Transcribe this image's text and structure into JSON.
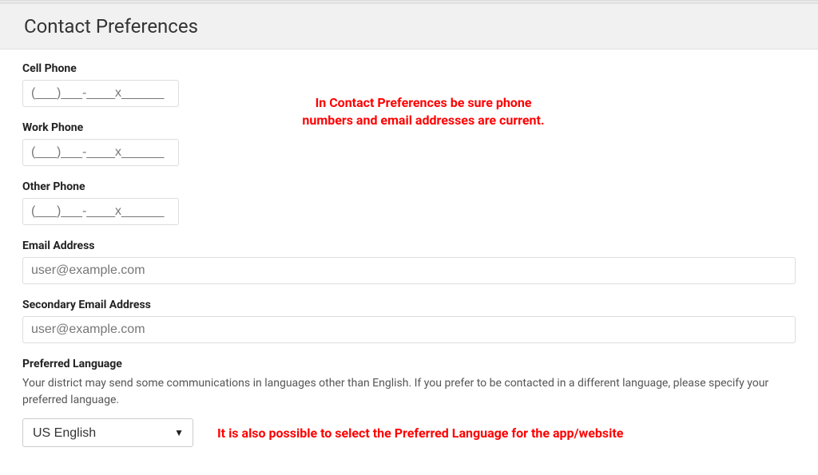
{
  "header": {
    "title": "Contact Preferences"
  },
  "fields": {
    "cell_phone": {
      "label": "Cell Phone",
      "placeholder": "(___)___-____x______"
    },
    "work_phone": {
      "label": "Work Phone",
      "placeholder": "(___)___-____x______"
    },
    "other_phone": {
      "label": "Other Phone",
      "placeholder": "(___)___-____x______"
    },
    "email": {
      "label": "Email Address",
      "placeholder": "user@example.com"
    },
    "secondary_email": {
      "label": "Secondary Email Address",
      "placeholder": "user@example.com"
    },
    "preferred_language": {
      "label": "Preferred Language",
      "help": "Your district may send some communications in languages other than English. If you prefer to be contacted in a different language, please specify your preferred language.",
      "value": "US English"
    }
  },
  "callouts": {
    "top": "In Contact Preferences be sure phone numbers and email addresses are current.",
    "bottom": "It is also possible to select the Preferred Language for the app/website"
  },
  "colors": {
    "callout": "#ff0000"
  }
}
